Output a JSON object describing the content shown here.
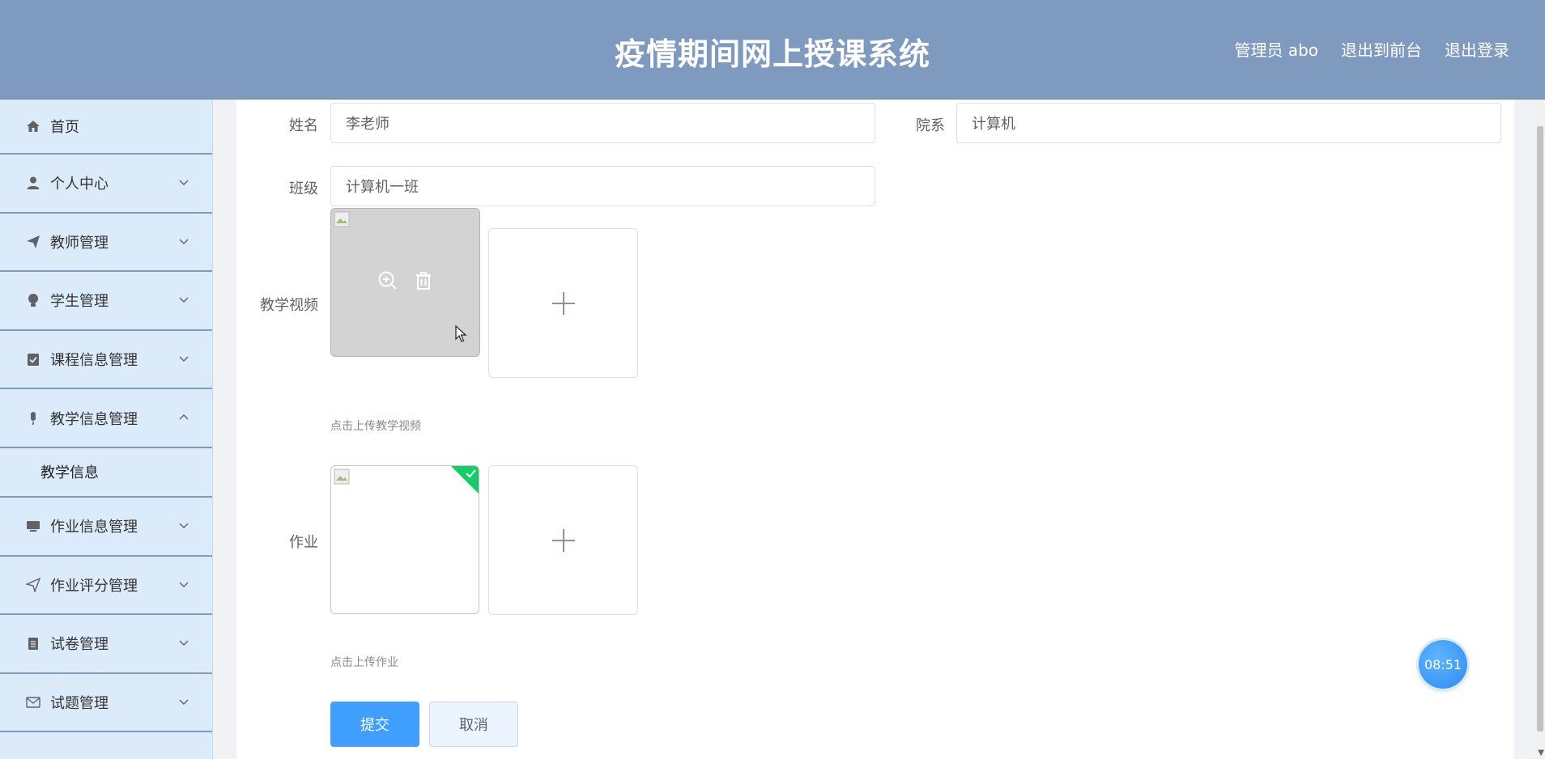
{
  "header": {
    "title": "疫情期间网上授课系统",
    "links": [
      "管理员 abo",
      "退出到前台",
      "退出登录"
    ]
  },
  "sidebar": {
    "items": [
      {
        "label": "首页",
        "icon": "home-icon"
      },
      {
        "label": "个人中心",
        "icon": "user-icon"
      },
      {
        "label": "教师管理",
        "icon": "send-icon"
      },
      {
        "label": "学生管理",
        "icon": "bulb-icon"
      },
      {
        "label": "课程信息管理",
        "icon": "clipboard-check-icon"
      },
      {
        "label": "教学信息管理",
        "icon": "microphone-icon",
        "expanded": true,
        "sub": [
          "教学信息"
        ]
      },
      {
        "label": "作业信息管理",
        "icon": "monitor-icon"
      },
      {
        "label": "作业评分管理",
        "icon": "paper-plane-icon"
      },
      {
        "label": "试卷管理",
        "icon": "document-icon"
      },
      {
        "label": "试题管理",
        "icon": "mail-icon"
      }
    ]
  },
  "form": {
    "name": {
      "label": "姓名",
      "value": "李老师"
    },
    "department": {
      "label": "院系",
      "value": "计算机"
    },
    "class": {
      "label": "班级",
      "value": "计算机一班"
    },
    "video": {
      "label": "教学视频",
      "hint": "点击上传教学视频"
    },
    "homework": {
      "label": "作业",
      "hint": "点击上传作业"
    },
    "submit_label": "提交",
    "cancel_label": "取消"
  },
  "clock": {
    "time": "08:51"
  },
  "colors": {
    "header": "#7f9abf",
    "sidebar": "#dcebfa",
    "primary": "#409eff",
    "success": "#13ce66"
  }
}
